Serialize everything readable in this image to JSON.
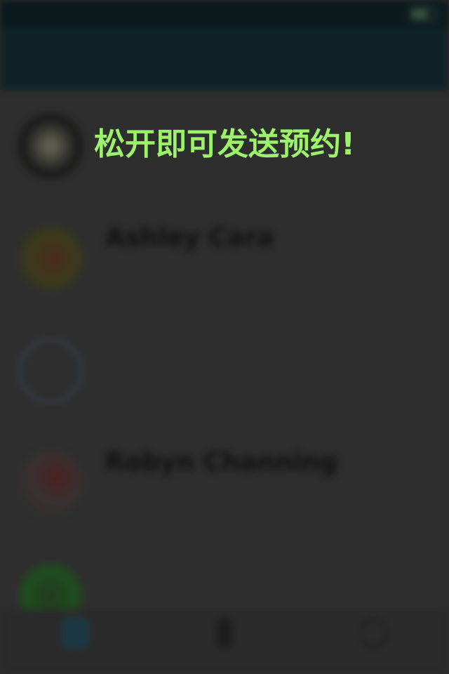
{
  "overlay": {
    "message": "松开即可发送预约!"
  },
  "colors": {
    "overlay_text": "#9cf36a",
    "nav_background": "#0f2327",
    "dimmed_background": "#2e2e2e"
  },
  "status_bar": {
    "carrier": "",
    "time": "",
    "battery_icon": "battery-icon"
  },
  "nav": {
    "title": ""
  },
  "chats": [
    {
      "name": "",
      "time": "",
      "preview": "",
      "avatar_icon": "avatar"
    },
    {
      "name": "Ashley Cara",
      "time": "",
      "preview": "",
      "avatar_icon": "avatar"
    },
    {
      "name": "",
      "time": "",
      "preview": "",
      "avatar_icon": "avatar"
    },
    {
      "name": "Robyn Channing",
      "time": "",
      "preview": "",
      "avatar_icon": "avatar"
    },
    {
      "name": "",
      "time": "",
      "preview": "",
      "avatar_icon": "avatar"
    }
  ],
  "tabs": [
    {
      "label": "",
      "icon": "chat-bubble-icon"
    },
    {
      "label": "",
      "icon": "contacts-icon"
    },
    {
      "label": "",
      "icon": "profile-icon"
    }
  ]
}
